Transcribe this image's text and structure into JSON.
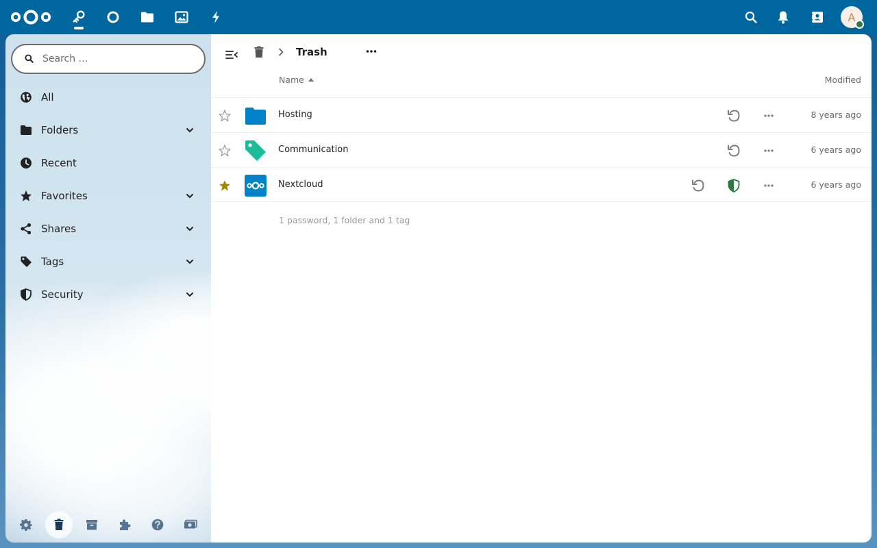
{
  "header": {
    "apps": [
      {
        "name": "passwords-app",
        "icon": "key-icon",
        "active": true
      },
      {
        "name": "dashboard-app",
        "icon": "circle-icon",
        "active": false
      },
      {
        "name": "files-app",
        "icon": "folder-icon",
        "active": false
      },
      {
        "name": "photos-app",
        "icon": "image-icon",
        "active": false
      },
      {
        "name": "activity-app",
        "icon": "bolt-icon",
        "active": false
      }
    ],
    "avatar_initial": "A",
    "colors": {
      "header_bg": "#00679e",
      "status_online": "#2d7b41"
    }
  },
  "sidebar": {
    "search": {
      "placeholder": "Search …",
      "value": ""
    },
    "items": [
      {
        "label": "All",
        "icon": "globe-icon",
        "expandable": false
      },
      {
        "label": "Folders",
        "icon": "folder-icon",
        "expandable": true
      },
      {
        "label": "Recent",
        "icon": "clock-icon",
        "expandable": false
      },
      {
        "label": "Favorites",
        "icon": "star-icon",
        "expandable": true
      },
      {
        "label": "Shares",
        "icon": "share-icon",
        "expandable": true
      },
      {
        "label": "Tags",
        "icon": "tag-icon",
        "expandable": true
      },
      {
        "label": "Security",
        "icon": "shield-icon",
        "expandable": true
      }
    ],
    "bottom": [
      {
        "name": "settings",
        "icon": "gear-icon",
        "active": false
      },
      {
        "name": "trash",
        "icon": "trash-icon",
        "active": true
      },
      {
        "name": "backups",
        "icon": "archive-icon",
        "active": false
      },
      {
        "name": "apps-and-extensions",
        "icon": "puzzle-icon",
        "active": false
      },
      {
        "name": "help",
        "icon": "help-icon",
        "active": false
      },
      {
        "name": "donate",
        "icon": "money-icon",
        "active": false
      }
    ]
  },
  "main": {
    "breadcrumb": {
      "title": "Trash"
    },
    "columns": {
      "name": "Name",
      "modified": "Modified",
      "sort": "name-ascending"
    },
    "rows": [
      {
        "name": "Hosting",
        "type": "folder",
        "favorite": false,
        "secure": false,
        "modified": "8 years ago"
      },
      {
        "name": "Communication",
        "type": "tag",
        "favorite": false,
        "secure": false,
        "modified": "6 years ago"
      },
      {
        "name": "Nextcloud",
        "type": "password",
        "favorite": true,
        "secure": true,
        "modified": "6 years ago"
      }
    ],
    "summary": "1 password, 1 folder and 1 tag",
    "colors": {
      "folder": "#0082c9",
      "tag": "#1abc9c",
      "favorite": "#a08b00",
      "secure": "#2d7b41",
      "nextcloud_bg": "#0082c9"
    }
  }
}
